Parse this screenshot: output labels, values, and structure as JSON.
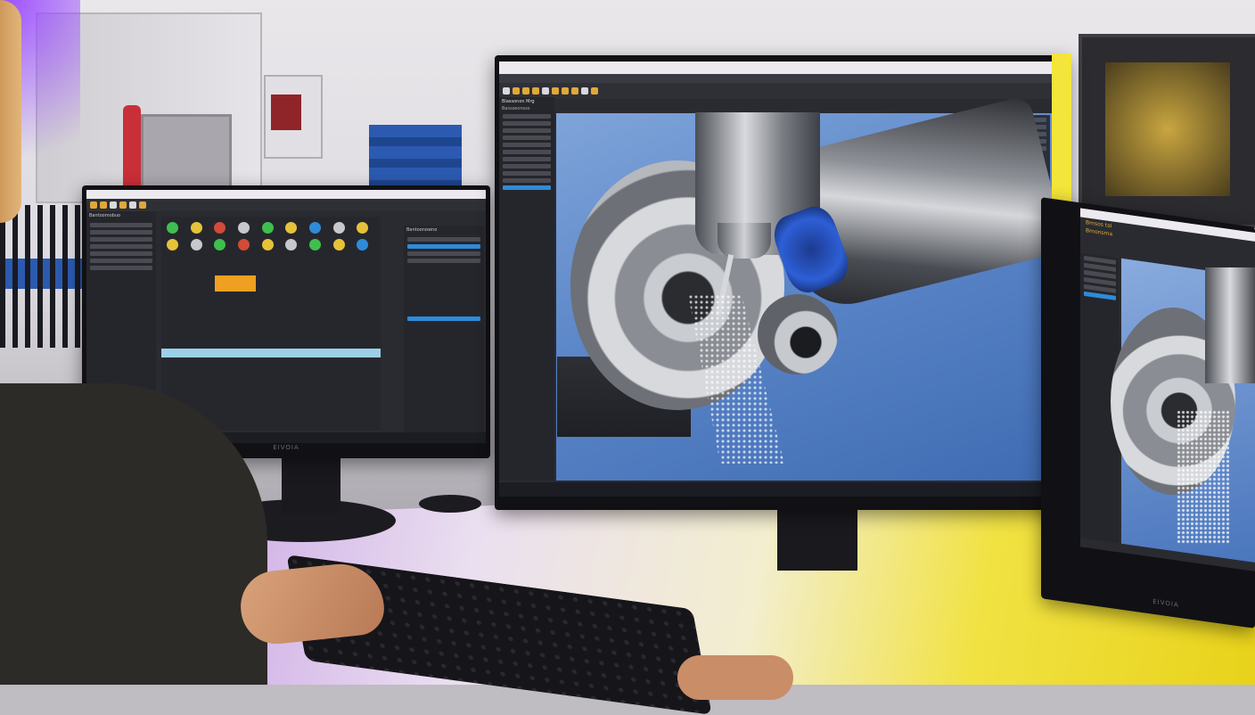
{
  "scene": "Machinist workstation with three monitors running CNC CAM software",
  "colors": {
    "accent_blue": "#2e8bd9",
    "toolbar_yellow": "#e0a83a",
    "desk_yellow": "#f1e243",
    "desk_purple": "#c69ee3",
    "viewport_sky": "#5b86c8"
  },
  "left_monitor": {
    "brand": "EIVOIA",
    "window_title": "Bantoomobuo",
    "panel_heading": "Bantoonowno"
  },
  "center_monitor": {
    "window_title": "Blassonon Mrg",
    "subtitle": "Bassseonsss",
    "viewport_content": "5-axis mill-turn simulation with chips"
  },
  "right_monitor": {
    "brand": "EIVOIA",
    "window_title": "Bmsos tal",
    "subtitle": "Bmonsma"
  }
}
